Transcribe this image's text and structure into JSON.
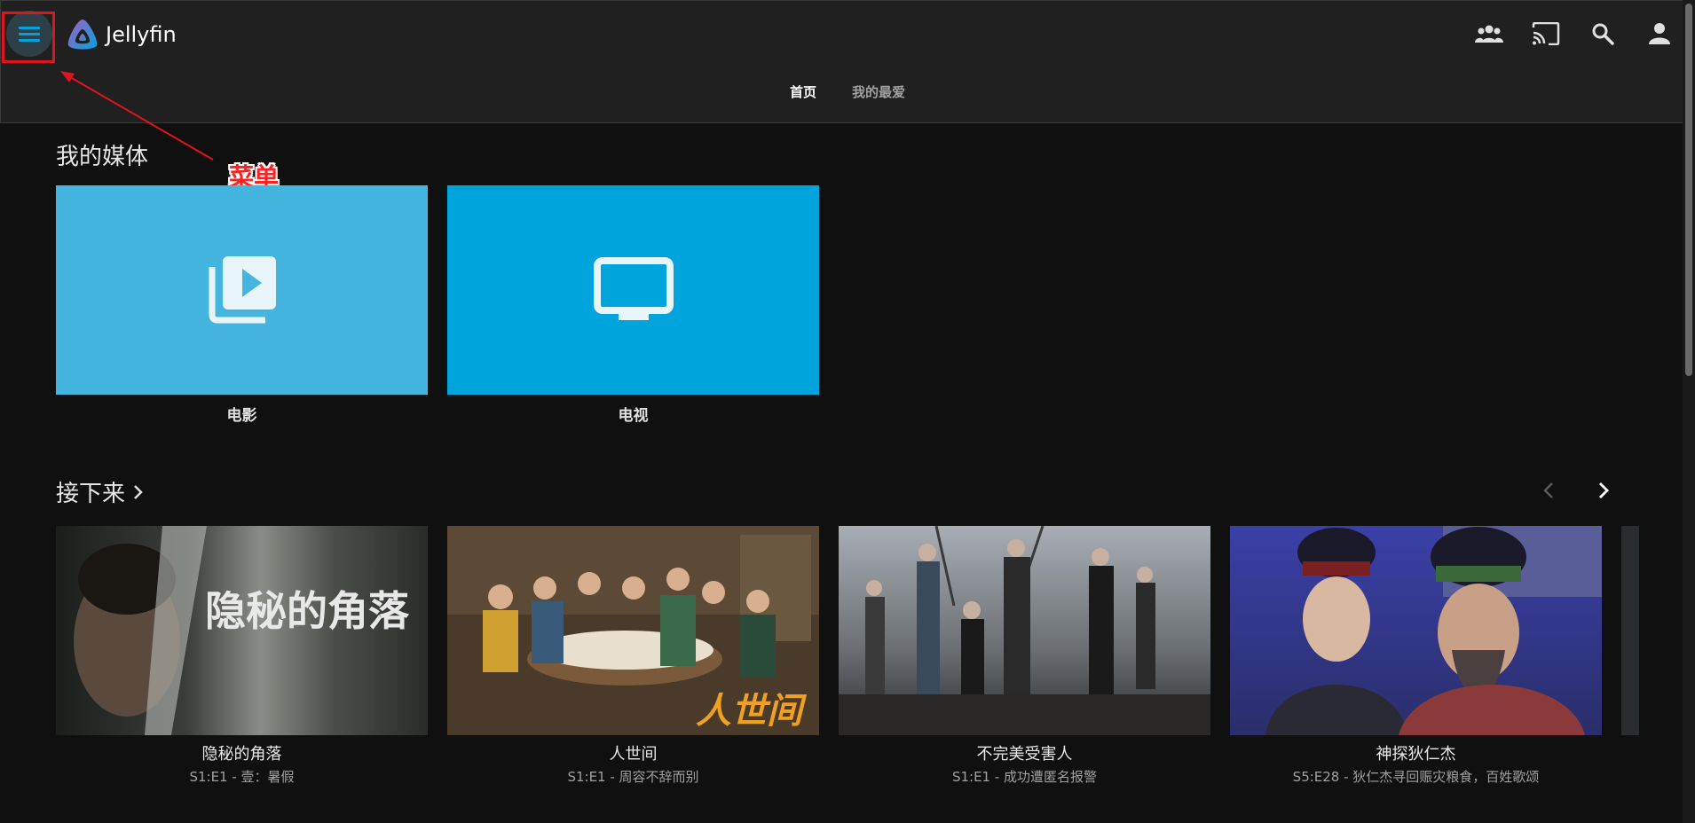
{
  "app": {
    "name": "Jellyfin"
  },
  "header": {
    "tabs": [
      {
        "label": "首页",
        "active": true
      },
      {
        "label": "我的最爱",
        "active": false
      }
    ],
    "icons": [
      "users-icon",
      "cast-icon",
      "search-icon",
      "user-icon"
    ]
  },
  "annotation": {
    "text": "菜单"
  },
  "my_media": {
    "title": "我的媒体",
    "libraries": [
      {
        "label": "电影",
        "icon": "video-library-icon",
        "color": "#43b5df"
      },
      {
        "label": "电视",
        "icon": "tv-icon",
        "color": "#00a4dc"
      }
    ]
  },
  "next_up": {
    "title": "接下来",
    "items": [
      {
        "title": "隐秘的角落",
        "subtitle": "S1:E1 - 壹：暑假",
        "poster_text": "隐秘的角落"
      },
      {
        "title": "人世间",
        "subtitle": "S1:E1 - 周容不辞而别",
        "poster_text": "人世间"
      },
      {
        "title": "不完美受害人",
        "subtitle": "S1:E1 - 成功遭匿名报警",
        "poster_text": ""
      },
      {
        "title": "神探狄仁杰",
        "subtitle": "S5:E28 - 狄仁杰寻回赈灾粮食，百姓歌颂",
        "poster_text": ""
      }
    ]
  },
  "colors": {
    "accent": "#00a4dc",
    "header_bg": "#202020",
    "page_bg": "#101010",
    "annotation": "#e0141e"
  }
}
